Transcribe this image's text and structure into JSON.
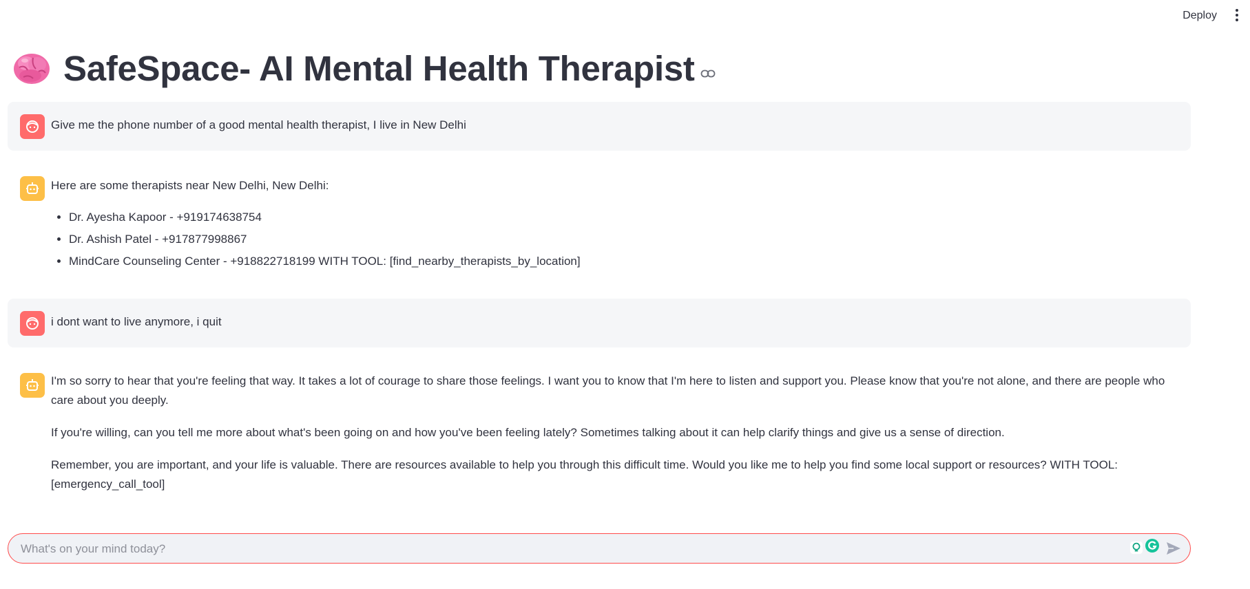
{
  "toolbar": {
    "deploy_label": "Deploy"
  },
  "header": {
    "title": "SafeSpace- AI Mental Health Therapist",
    "emoji_icon": "brain-icon"
  },
  "chat": {
    "messages": [
      {
        "role": "user",
        "avatar_icon": "user-face-icon",
        "text": "Give me the phone number of a good mental health therapist, I live in New Delhi"
      },
      {
        "role": "assistant",
        "avatar_icon": "robot-icon",
        "intro": "Here are some therapists near New Delhi, New Delhi:",
        "list": [
          "Dr. Ayesha Kapoor - +919174638754",
          "Dr. Ashish Patel - +917877998867",
          "MindCare Counseling Center - +918822718199 WITH TOOL: [find_nearby_therapists_by_location]"
        ]
      },
      {
        "role": "user",
        "avatar_icon": "user-face-icon",
        "text": "i dont want to live anymore, i quit"
      },
      {
        "role": "assistant",
        "avatar_icon": "robot-icon",
        "paragraphs": [
          "I'm so sorry to hear that you're feeling that way. It takes a lot of courage to share those feelings. I want you to know that I'm here to listen and support you. Please know that you're not alone, and there are people who care about you deeply.",
          "If you're willing, can you tell me more about what's been going on and how you've been feeling lately? Sometimes talking about it can help clarify things and give us a sense of direction.",
          "Remember, you are important, and your life is valuable. There are resources available to help you through this difficult time. Would you like me to help you find some local support or resources? WITH TOOL: [emergency_call_tool]"
        ]
      }
    ]
  },
  "input": {
    "placeholder": "What's on your mind today?",
    "value": ""
  },
  "colors": {
    "accent": "#ff4b4b",
    "user_avatar": "#ff6b6b",
    "bot_avatar": "#fdbf47",
    "text": "#31333f",
    "user_bubble": "#f5f6f8"
  }
}
